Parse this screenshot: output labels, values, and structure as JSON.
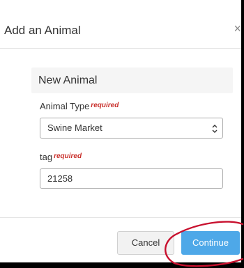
{
  "dialog": {
    "title": "Add an Animal",
    "close_glyph": "×"
  },
  "card": {
    "heading": "New Animal"
  },
  "fields": {
    "animal_type": {
      "label": "Animal Type",
      "required": "required",
      "value": "Swine Market"
    },
    "tag": {
      "label": "tag",
      "required": "required",
      "value": "21258"
    }
  },
  "footer": {
    "cancel_label": "Cancel",
    "continue_label": "Continue"
  },
  "colors": {
    "primary": "#4ea8e8",
    "required": "#c9302c",
    "highlight": "#c8102e"
  },
  "icons": {
    "close": "close-icon",
    "select": "updown-chevron-icon"
  }
}
